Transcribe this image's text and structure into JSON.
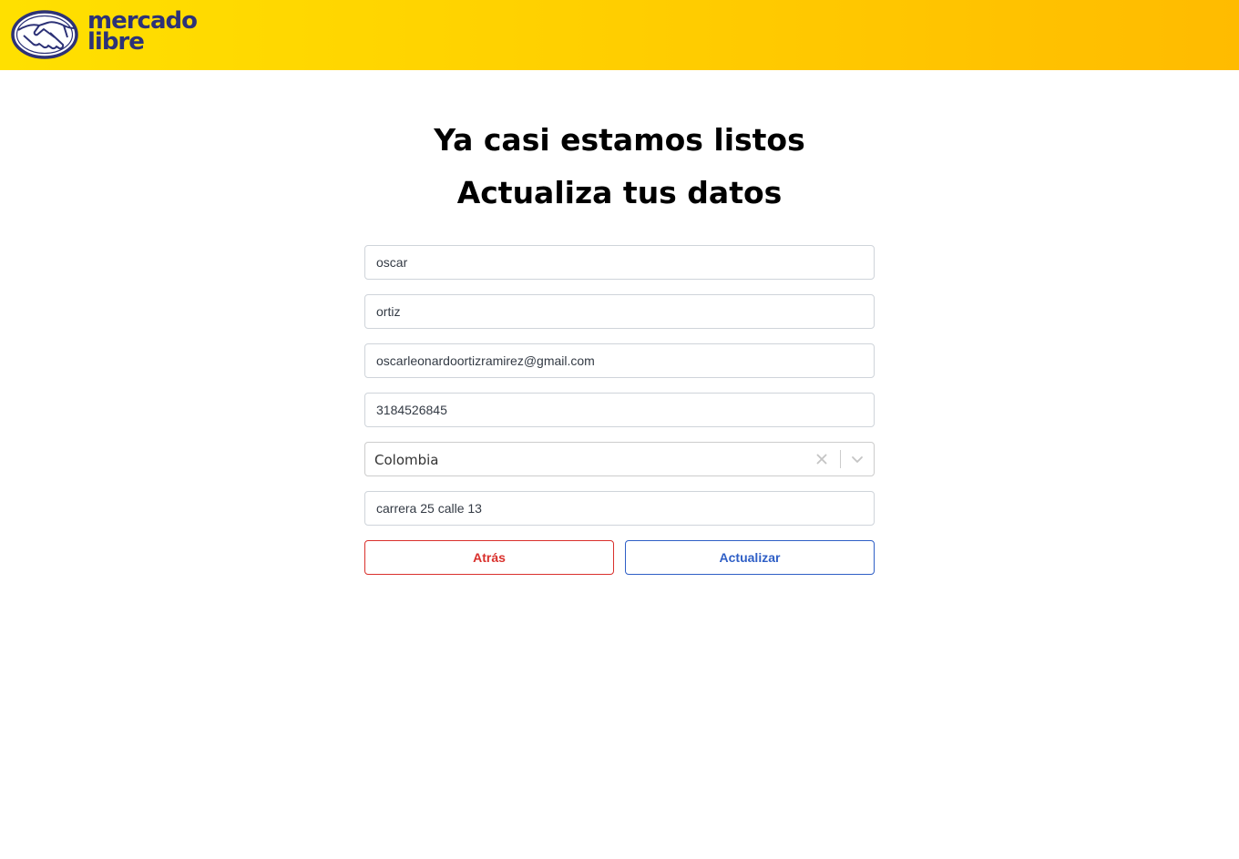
{
  "header": {
    "logo_text_line1": "mercado",
    "logo_text_line2": "libre",
    "brand_color": "#2d3277",
    "background_color": "#ffe000"
  },
  "titles": {
    "line1": "Ya casi estamos listos",
    "line2": "Actualiza tus datos"
  },
  "form": {
    "first_name": "oscar",
    "last_name": "ortiz",
    "email": "oscarleonardoortizramirez@gmail.com",
    "phone": "3184526845",
    "country": {
      "selected": "Colombia",
      "clear_icon": "close-icon",
      "dropdown_icon": "chevron-down-icon"
    },
    "address": "carrera 25 calle 13"
  },
  "buttons": {
    "back_label": "Atrás",
    "update_label": "Actualizar",
    "back_color": "#d9302c",
    "update_color": "#2f5fc6"
  }
}
